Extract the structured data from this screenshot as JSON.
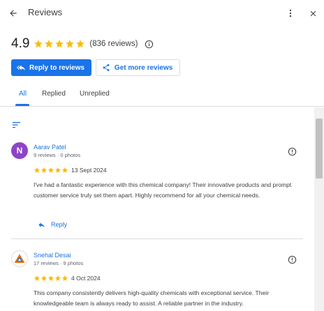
{
  "header": {
    "title": "Reviews",
    "back_icon": "arrow-left-icon",
    "more_icon": "more-vert-icon",
    "close_icon": "close-icon"
  },
  "summary": {
    "rating": "4.9",
    "stars": 5,
    "review_count": "(836 reviews)",
    "star_color": "#fbbc04"
  },
  "actions": {
    "reply_label": "Reply to reviews",
    "get_more_label": "Get more reviews",
    "accent_color": "#1a73e8"
  },
  "tabs": [
    {
      "label": "All",
      "active": true
    },
    {
      "label": "Replied",
      "active": false
    },
    {
      "label": "Unreplied",
      "active": false
    }
  ],
  "reviews": [
    {
      "avatar_letter": "N",
      "name": "Aarav Patel",
      "meta": "9 reviews · 0 photos",
      "stars": 5,
      "date": "13 Sept 2024",
      "text": "I've had a fantastic experience with this chemical company! Their innovative products and prompt customer service truly set them apart. Highly recommend for all your chemical needs.",
      "reply_label": "Reply"
    },
    {
      "avatar_letter": "",
      "name": "Snehal Desai",
      "meta": "17 reviews · 9 photos",
      "stars": 5,
      "date": "4 Oct 2024",
      "text": "This company consistently delivers high-quality chemicals with exceptional service. Their knowledgeable team is always ready to assist. A reliable partner in the industry."
    }
  ]
}
